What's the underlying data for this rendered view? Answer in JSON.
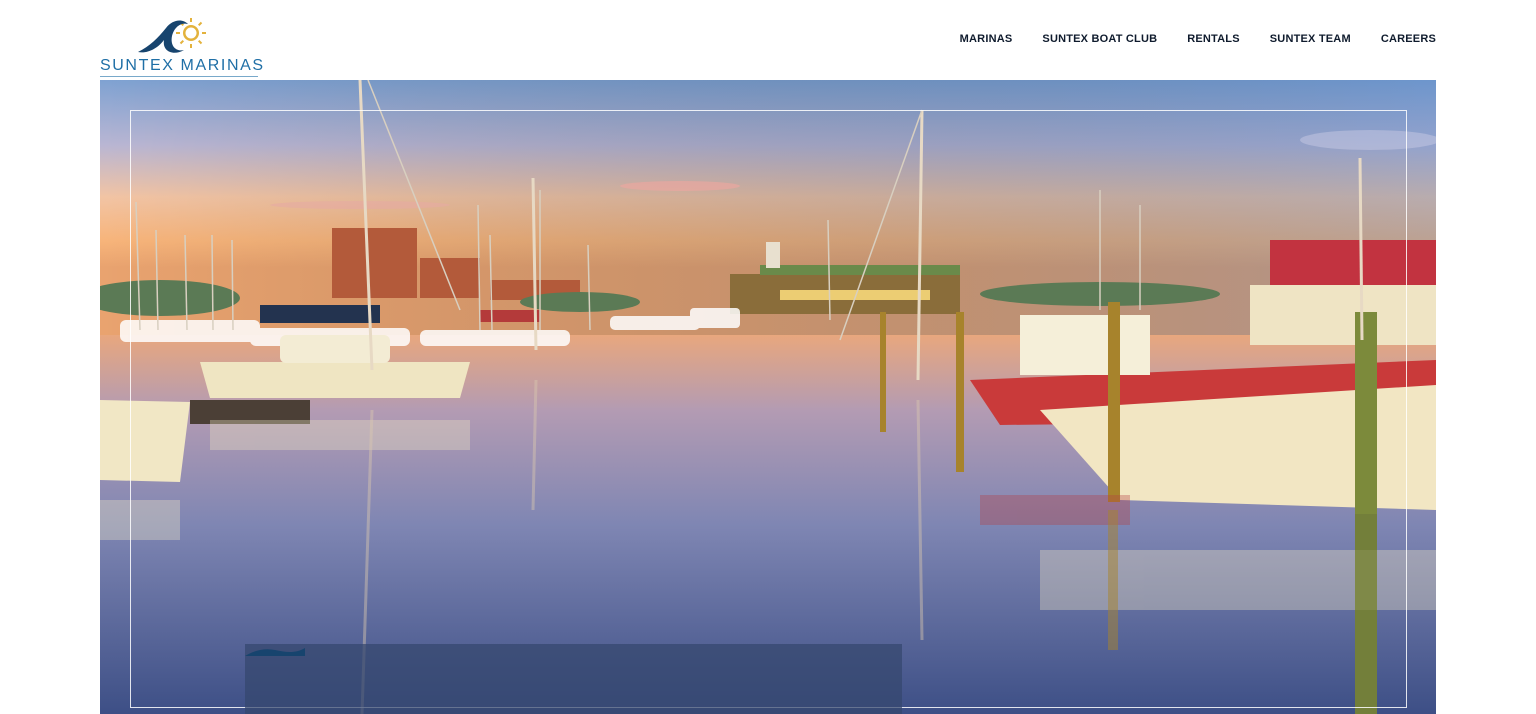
{
  "brand": {
    "name": "SUNTEX MARINAS",
    "logo_icon": "wave-sun-logo",
    "colors": {
      "primary": "#1f6fa6",
      "sun": "#e3b23c",
      "wave": "#17446e"
    }
  },
  "nav": {
    "items": [
      {
        "label": "MARINAS"
      },
      {
        "label": "SUNTEX BOAT CLUB"
      },
      {
        "label": "RENTALS"
      },
      {
        "label": "SUNTEX TEAM"
      },
      {
        "label": "CAREERS"
      }
    ]
  },
  "hero": {
    "image": "marina-sunset-photo"
  }
}
